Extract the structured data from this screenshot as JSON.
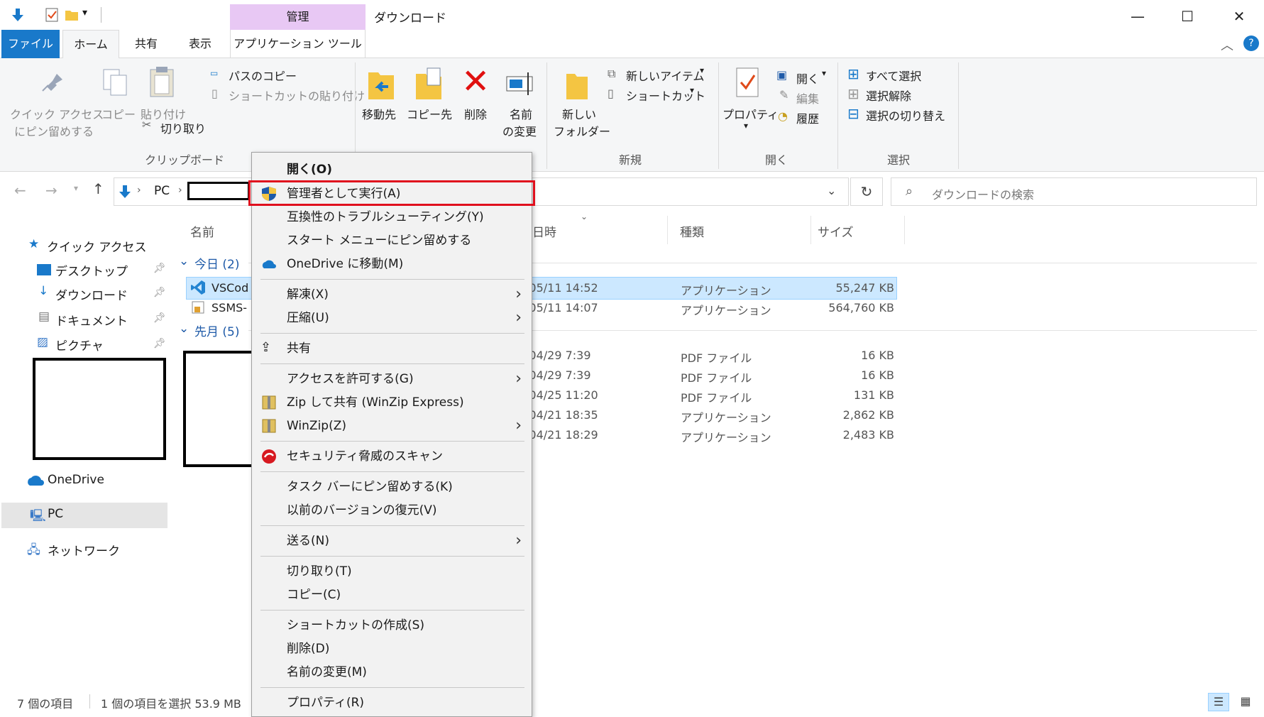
{
  "window": {
    "title": "ダウンロード",
    "context_tab_header": "管理",
    "minimize": "—",
    "maximize": "☐",
    "close": "✕"
  },
  "tabs": {
    "file": "ファイル",
    "home": "ホーム",
    "share": "共有",
    "view": "表示",
    "app_tools": "アプリケーション ツール"
  },
  "ribbon": {
    "pin_quick_access_1": "クイック アクセス",
    "pin_quick_access_2": "にピン留めする",
    "copy": "コピー",
    "paste": "貼り付け",
    "copy_path": "パスのコピー",
    "paste_shortcut": "ショートカットの貼り付け",
    "cut": "切り取り",
    "clipboard_group": "クリップボード",
    "move_to": "移動先",
    "copy_to": "コピー先",
    "delete": "削除",
    "rename_1": "名前",
    "rename_2": "の変更",
    "new_folder_1": "新しい",
    "new_folder_2": "フォルダー",
    "new_item": "新しいアイテム",
    "shortcut": "ショートカット",
    "new_group": "新規",
    "properties": "プロパティ",
    "open": "開く",
    "edit": "編集",
    "history": "履歴",
    "open_group": "開く",
    "select_all": "すべて選択",
    "select_none": "選択解除",
    "invert_selection": "選択の切り替え",
    "select_group": "選択"
  },
  "address": {
    "pc": "PC",
    "search_placeholder": "ダウンロードの検索"
  },
  "nav": {
    "quick_access": "クイック アクセス",
    "desktop": "デスクトップ",
    "downloads": "ダウンロード",
    "documents": "ドキュメント",
    "pictures": "ピクチャ",
    "onedrive": "OneDrive",
    "pc": "PC",
    "network": "ネットワーク"
  },
  "columns": {
    "name": "名前",
    "date": "日時",
    "type": "種類",
    "size": "サイズ"
  },
  "groups": {
    "today": "今日 (2)",
    "last_month": "先月 (5)"
  },
  "files": [
    {
      "name": "VSCod",
      "date": "/05/11 14:52",
      "type": "アプリケーション",
      "size": "55,247 KB",
      "selected": true
    },
    {
      "name": "SSMS-",
      "date": "/05/11 14:07",
      "type": "アプリケーション",
      "size": "564,760 KB",
      "selected": false
    },
    {
      "name": "",
      "date": "/04/29 7:39",
      "type": "PDF ファイル",
      "size": "16 KB",
      "selected": false
    },
    {
      "name": "",
      "date": "/04/29 7:39",
      "type": "PDF ファイル",
      "size": "16 KB",
      "selected": false
    },
    {
      "name": "",
      "date": "/04/25 11:20",
      "type": "PDF ファイル",
      "size": "131 KB",
      "selected": false
    },
    {
      "name": "",
      "date": "/04/21 18:35",
      "type": "アプリケーション",
      "size": "2,862 KB",
      "selected": false
    },
    {
      "name": "",
      "date": "/04/21 18:29",
      "type": "アプリケーション",
      "size": "2,483 KB",
      "selected": false
    }
  ],
  "status": {
    "count": "7 個の項目",
    "selected": "1 個の項目を選択  53.9 MB"
  },
  "context_menu": {
    "open": "開く(O)",
    "run_as_admin": "管理者として実行(A)",
    "troubleshoot": "互換性のトラブルシューティング(Y)",
    "pin_start": "スタート メニューにピン留めする",
    "onedrive_move": "OneDrive に移動(M)",
    "extract": "解凍(X)",
    "compress": "圧縮(U)",
    "share": "共有",
    "give_access": "アクセスを許可する(G)",
    "zip_share": "Zip して共有 (WinZip Express)",
    "winzip": "WinZip(Z)",
    "security_scan": "セキュリティ脅威のスキャン",
    "pin_taskbar": "タスク バーにピン留めする(K)",
    "restore_versions": "以前のバージョンの復元(V)",
    "send_to": "送る(N)",
    "cut": "切り取り(T)",
    "copy": "コピー(C)",
    "create_shortcut": "ショートカットの作成(S)",
    "delete": "削除(D)",
    "rename": "名前の変更(M)",
    "properties": "プロパティ(R)"
  },
  "colors": {
    "accent": "#1979ca",
    "highlight_border": "#e0101e",
    "context_tab": "#e8c8f4",
    "selection": "#cce8ff"
  }
}
